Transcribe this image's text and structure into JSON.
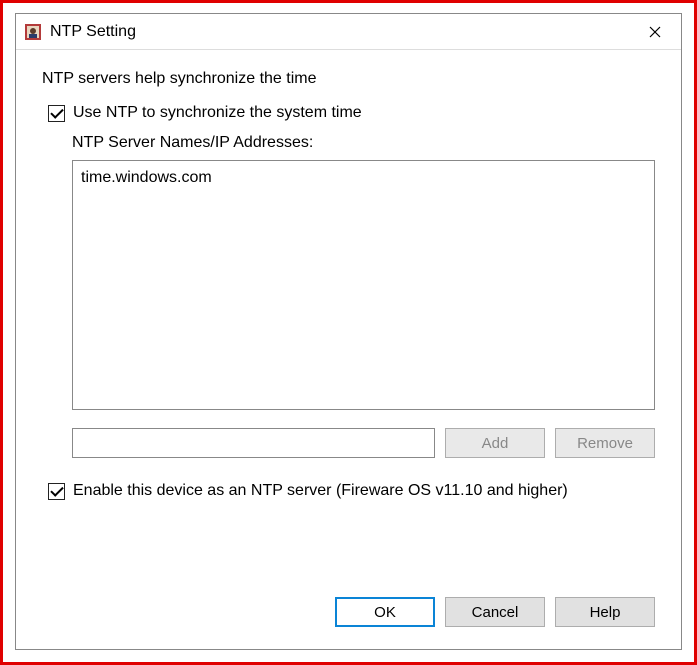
{
  "window": {
    "title": "NTP Setting"
  },
  "content": {
    "description": "NTP servers help synchronize the time",
    "use_ntp_label": "Use NTP to synchronize the system time",
    "use_ntp_checked": true,
    "server_list_label": "NTP Server Names/IP Addresses:",
    "servers": [
      "time.windows.com"
    ],
    "new_server_value": "",
    "add_label": "Add",
    "remove_label": "Remove",
    "enable_ntp_server_label": "Enable this device as an NTP server (Fireware OS v11.10 and higher)",
    "enable_ntp_server_checked": true
  },
  "buttons": {
    "ok": "OK",
    "cancel": "Cancel",
    "help": "Help"
  }
}
